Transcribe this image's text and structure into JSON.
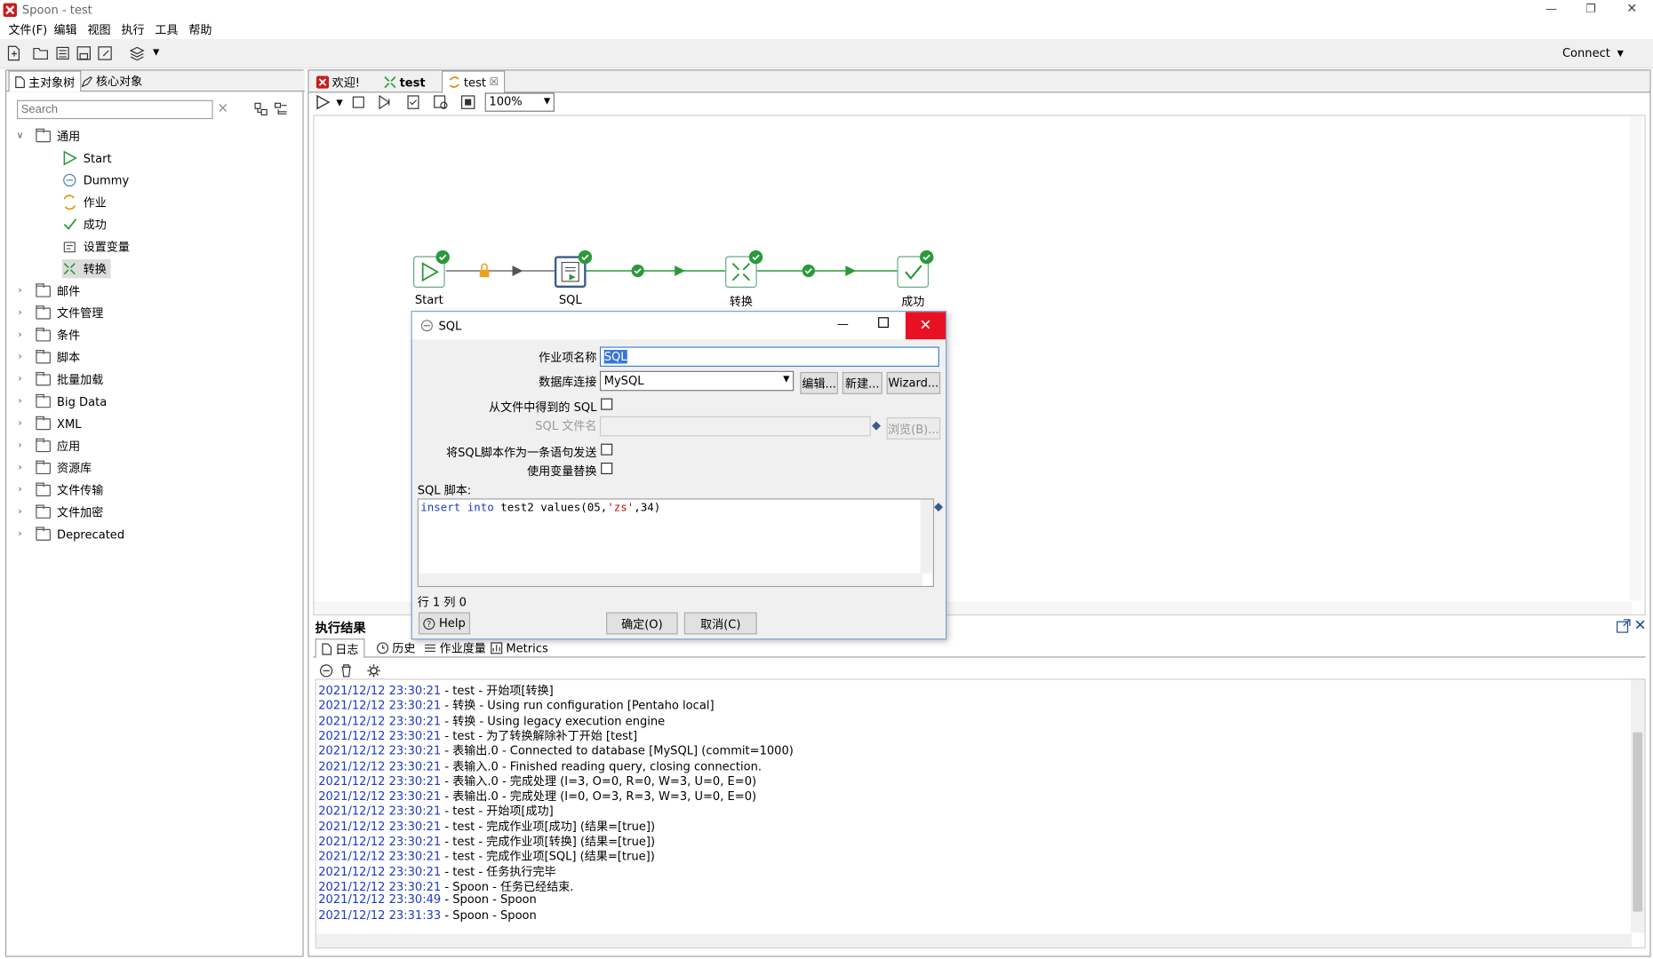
{
  "window": {
    "title": "Spoon - test"
  },
  "menu": [
    "文件(F)",
    "编辑",
    "视图",
    "执行",
    "工具",
    "帮助"
  ],
  "toolbar": {
    "connect_label": "Connect"
  },
  "left": {
    "tabs": [
      "主对象树",
      "核心对象"
    ],
    "search_placeholder": "Search",
    "general_folder": "通用",
    "general_items": [
      "Start",
      "Dummy",
      "作业",
      "成功",
      "设置变量",
      "转换"
    ],
    "folders": [
      "邮件",
      "文件管理",
      "条件",
      "脚本",
      "批量加载",
      "Big Data",
      "XML",
      "应用",
      "资源库",
      "文件传输",
      "文件加密",
      "Deprecated"
    ]
  },
  "editor": {
    "tabs": [
      "欢迎!",
      "test",
      "test"
    ],
    "zoom": "100%"
  },
  "flow": {
    "nodes": [
      "Start",
      "SQL",
      "转换",
      "成功"
    ]
  },
  "results": {
    "title": "执行结果",
    "tabs": [
      "日志",
      "历史",
      "作业度量",
      "Metrics"
    ],
    "log": [
      {
        "ts": "2021/12/12 23:30:21",
        "msg": " - test - 开始项[转换]"
      },
      {
        "ts": "2021/12/12 23:30:21",
        "msg": " - 转换 - Using run configuration [Pentaho local]"
      },
      {
        "ts": "2021/12/12 23:30:21",
        "msg": " - 转换 - Using legacy execution engine"
      },
      {
        "ts": "2021/12/12 23:30:21",
        "msg": " - test - 为了转换解除补丁开始  [test]"
      },
      {
        "ts": "2021/12/12 23:30:21",
        "msg": " - 表输出.0 - Connected to database [MySQL] (commit=1000)"
      },
      {
        "ts": "2021/12/12 23:30:21",
        "msg": " - 表输入.0 - Finished reading query, closing connection."
      },
      {
        "ts": "2021/12/12 23:30:21",
        "msg": " - 表输入.0 - 完成处理 (I=3, O=0, R=0, W=3, U=0, E=0)"
      },
      {
        "ts": "2021/12/12 23:30:21",
        "msg": " - 表输出.0 - 完成处理 (I=0, O=3, R=3, W=3, U=0, E=0)"
      },
      {
        "ts": "2021/12/12 23:30:21",
        "msg": " - test - 开始项[成功]"
      },
      {
        "ts": "2021/12/12 23:30:21",
        "msg": " - test - 完成作业项[成功] (结果=[true])"
      },
      {
        "ts": "2021/12/12 23:30:21",
        "msg": " - test - 完成作业项[转换] (结果=[true])"
      },
      {
        "ts": "2021/12/12 23:30:21",
        "msg": " - test - 完成作业项[SQL] (结果=[true])"
      },
      {
        "ts": "2021/12/12 23:30:21",
        "msg": " - test - 任务执行完毕"
      },
      {
        "ts": "2021/12/12 23:30:21",
        "msg": " - Spoon - 任务已经结束."
      },
      {
        "ts": "2021/12/12 23:30:49",
        "msg": " - Spoon - Spoon"
      },
      {
        "ts": "2021/12/12 23:31:33",
        "msg": " - Spoon - Spoon"
      }
    ]
  },
  "dialog": {
    "title": "SQL",
    "name_label": "作业项名称",
    "name_value": "SQL",
    "db_label": "数据库连接",
    "db_value": "MySQL",
    "edit_btn": "编辑...",
    "new_btn": "新建...",
    "wizard_btn": "Wizard...",
    "from_file_label": "从文件中得到的 SQL",
    "file_label": "SQL 文件名",
    "browse_btn": "浏览(B)...",
    "single_stmt_label": "将SQL脚本作为一条语句发送",
    "var_sub_label": "使用变量替换",
    "script_label": "SQL 脚本:",
    "script_kw1": "insert",
    "script_kw2": "into",
    "script_mid": " test2 values(05,",
    "script_str": "'zs'",
    "script_end": ",34)",
    "status": "行 1 列 0",
    "help_btn": "Help",
    "ok_btn": "确定(O)",
    "cancel_btn": "取消(C)"
  }
}
